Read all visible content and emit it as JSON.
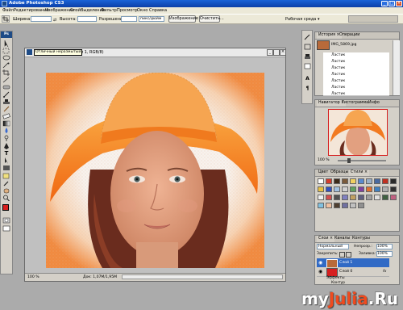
{
  "window": {
    "title": "Adobe Photoshop CS3",
    "controls": [
      "_",
      "□",
      "×"
    ]
  },
  "menu": [
    "Файл",
    "Редактирование",
    "Изображение",
    "Слой",
    "Выделение",
    "Фильтр",
    "Просмотр",
    "Окно",
    "Справка"
  ],
  "options": {
    "width_label": "Ширина:",
    "height_label": "Высота:",
    "resolution_label": "Разрешение:",
    "units_value": "пикс/дюйм",
    "front_image_button": "Изображение",
    "clear_button": "Очистить...",
    "workspace_label": "Рабочая среда ▾"
  },
  "document": {
    "title": "Ps (Слой 1, RGB/8)",
    "tooltip": "Отличный неразмытый",
    "zoom": "100 %",
    "doc_info": "Док: 1,07М/1,95М"
  },
  "history_panel": {
    "tabs": [
      "История ×",
      "Операции"
    ],
    "snapshot": "IMG_5869.jpg",
    "items": [
      "Ластик",
      "Ластик",
      "Ластик",
      "Ластик",
      "Ластик",
      "Ластик",
      "Ластик"
    ]
  },
  "navigator_panel": {
    "tabs": [
      "Навигатор ×",
      "Гистограмма",
      "Инфо"
    ],
    "zoom": "100 %"
  },
  "swatches_panel": {
    "tabs": [
      "Цвет",
      "Образцы",
      "Стили ×"
    ],
    "styles": [
      "#ffffff",
      "#d63b2a",
      "#3b2a1a",
      "#7a5a3a",
      "#f0d060",
      "#5a8ad0",
      "#9ab0c8",
      "#4a6aa0",
      "#c03020",
      "#2a2a2a",
      "#e8c040",
      "#3050c0",
      "#a0c0e0",
      "#d0d0d0",
      "#60a060",
      "#8040a0",
      "#e07030",
      "#4080c0",
      "#b0b0b0",
      "#303030",
      "#f0f0f0",
      "#d05050",
      "#505050",
      "#8080c0",
      "#c0a060",
      "#606080",
      "#a0a0a0",
      "#e0e0e0",
      "#406040",
      "#c06080",
      "#80c0e0",
      "#f0c0a0",
      "#504030",
      "#7070a0",
      "#c0c0c0",
      "#909090"
    ]
  },
  "layers_panel": {
    "tabs": [
      "Слои ×",
      "Каналы",
      "Контуры"
    ],
    "blend_mode": "Нормальный",
    "opacity_label": "Непрозр.:",
    "opacity_value": "100%",
    "lock_label": "Закрепить:",
    "fill_label": "Заливка:",
    "fill_value": "100%",
    "layers": [
      {
        "name": "Слой 1",
        "fx": ""
      },
      {
        "name": "Слой 0",
        "fx": "fx"
      }
    ],
    "effects_label": "Эффекты",
    "sub_effect": "Контур"
  },
  "watermark": {
    "part1": "my",
    "part2": "Julia",
    "part3": ".Ru"
  },
  "colors": {
    "accent": "#1a63d8",
    "foreground": "#d61f1f",
    "background": "#ffffff",
    "hat": "#f47a1a"
  }
}
